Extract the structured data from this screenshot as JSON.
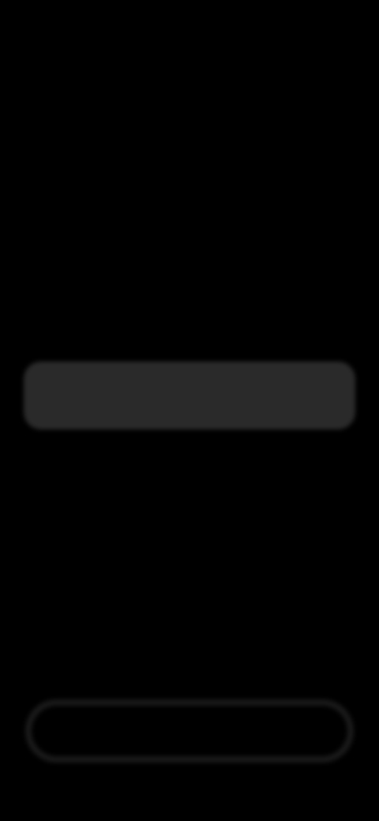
{
  "status_bar": {
    "time": "",
    "right_indicators": ""
  },
  "title": "",
  "picker": {
    "items": [
      "",
      "",
      "",
      "",
      ""
    ],
    "selected_index": 2
  },
  "bottom_label": "",
  "bottom_button_label": ""
}
